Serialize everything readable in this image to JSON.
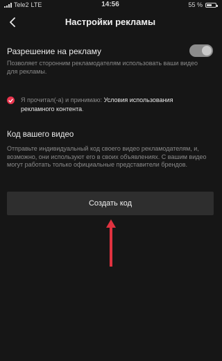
{
  "status_bar": {
    "carrier": "Tele2",
    "network": "LTE",
    "time": "14:56",
    "battery_percent": "55 %",
    "battery_level": 0.55
  },
  "nav": {
    "back_icon": "chevron-left-icon",
    "title": "Настройки рекламы"
  },
  "ad_permission": {
    "label": "Разрешение на рекламу",
    "enabled": true,
    "description": "Позволяет сторонним рекламодателям использовать ваши видео для рекламы."
  },
  "consent": {
    "checked": true,
    "text": "Я прочитал(-а) и принимаю: ",
    "link": "Условия использования рекламного контента",
    "end": "."
  },
  "video_code": {
    "title": "Код вашего видео",
    "description": "Отправьте индивидуальный код своего видео рекламодателям, и, возможно, они используют его в своих объявлениях. С вашим видео могут работать только официальные представители брендов."
  },
  "create_button": {
    "label": "Создать код"
  },
  "colors": {
    "background": "#161616",
    "accent_red": "#e8344d",
    "button_bg": "#2e2e2e",
    "arrow": "#e0323f"
  }
}
